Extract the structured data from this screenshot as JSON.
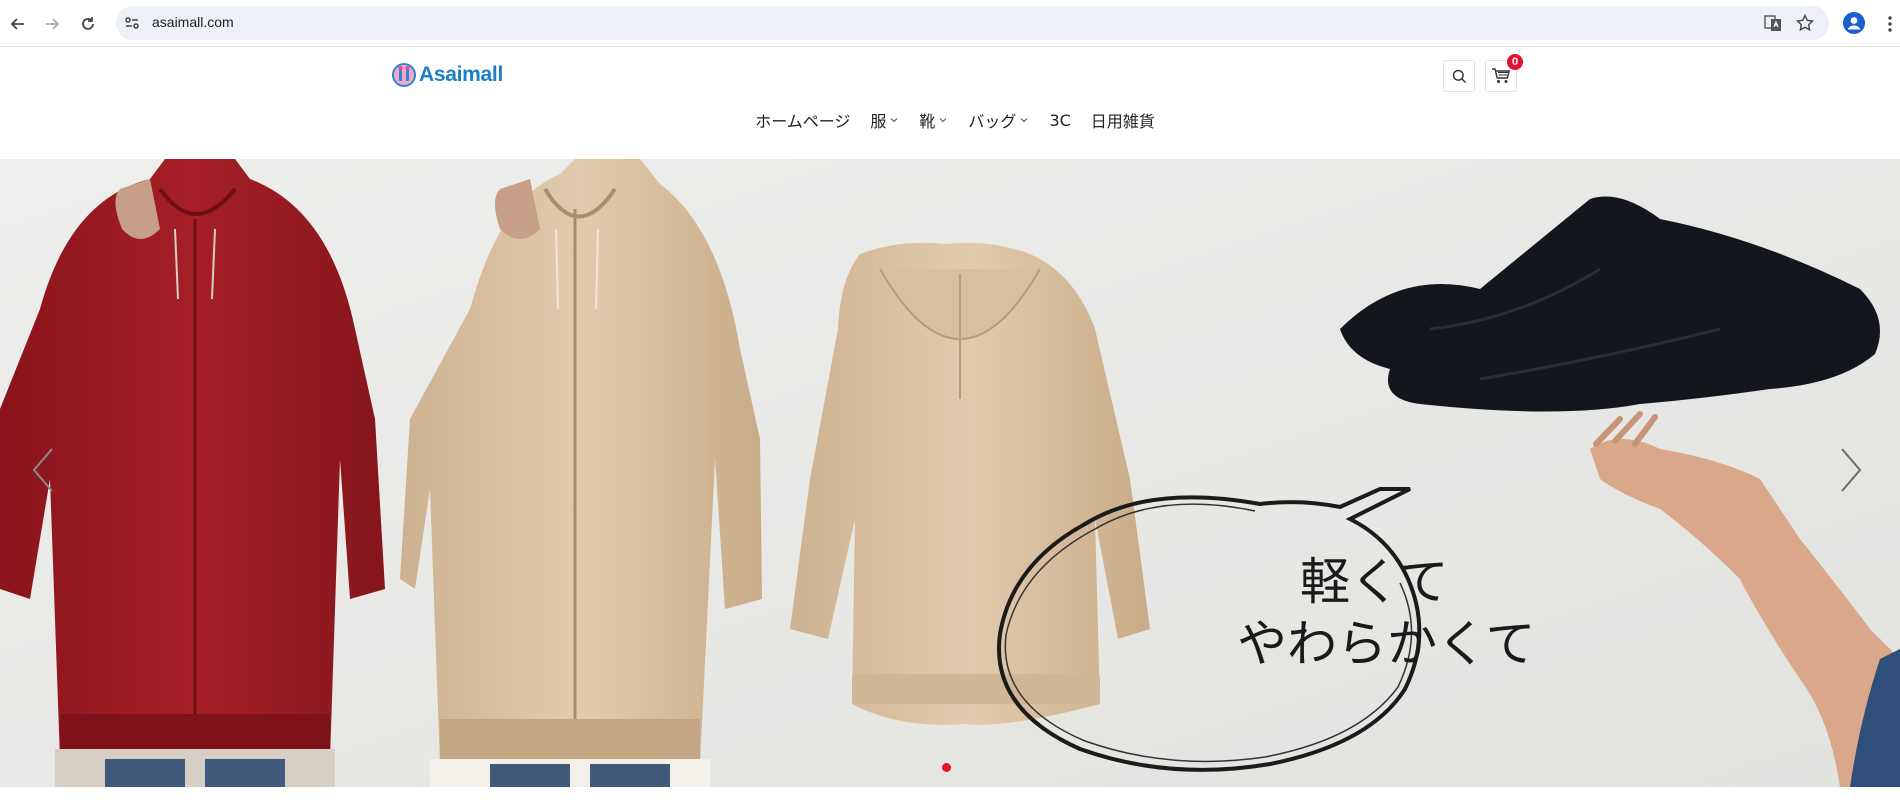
{
  "browser": {
    "url": "asaimall.com",
    "icons": [
      "back-icon",
      "forward-icon",
      "reload-icon",
      "site-info-icon",
      "translate-icon",
      "bookmark-star-icon",
      "profile-icon",
      "menu-kebab-icon"
    ]
  },
  "site": {
    "logo_text": "Asaimall",
    "cart_count": "0",
    "menu": [
      {
        "label": "ホームページ",
        "has_dropdown": false
      },
      {
        "label": "服",
        "has_dropdown": true
      },
      {
        "label": "靴",
        "has_dropdown": true
      },
      {
        "label": "バッグ",
        "has_dropdown": true
      },
      {
        "label": "3C",
        "has_dropdown": false
      },
      {
        "label": "日用雑貨",
        "has_dropdown": false
      }
    ]
  },
  "hero": {
    "caption_line1": "軽くて",
    "caption_line2": "やわらかくて",
    "slide_index": 1,
    "colors": {
      "accent": "#e6112e",
      "red_hoodie": "#9e1c22",
      "beige_hoodie": "#dcc3a4"
    }
  }
}
